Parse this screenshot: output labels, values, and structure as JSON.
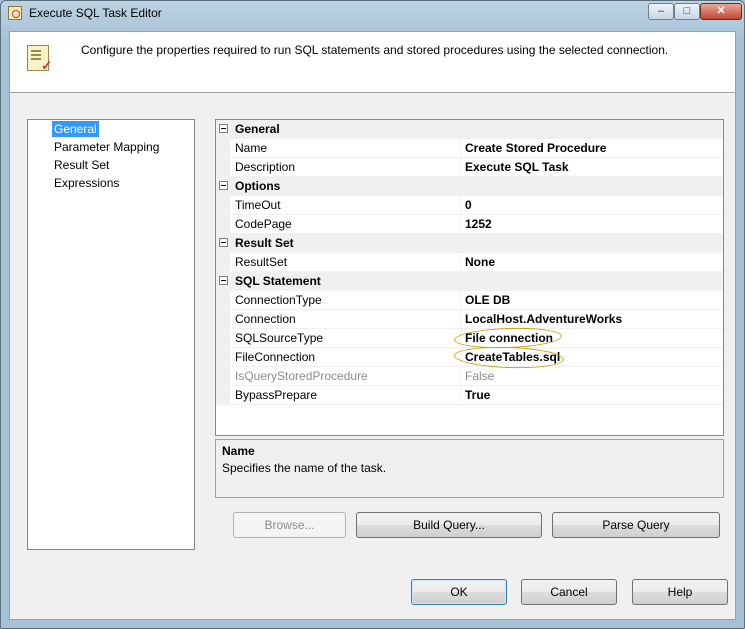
{
  "window": {
    "title": "Execute SQL Task Editor",
    "controls": {
      "minimize": "–",
      "maximize": "□",
      "close": "✕"
    }
  },
  "header": {
    "description": "Configure the properties required to run SQL statements and stored procedures using the selected connection."
  },
  "nav": {
    "items": [
      "General",
      "Parameter Mapping",
      "Result Set",
      "Expressions"
    ],
    "selected": "General"
  },
  "properties": {
    "categories": [
      {
        "label": "General",
        "rows": [
          {
            "name": "Name",
            "value": "Create Stored Procedure"
          },
          {
            "name": "Description",
            "value": "Execute SQL Task"
          }
        ]
      },
      {
        "label": "Options",
        "rows": [
          {
            "name": "TimeOut",
            "value": "0"
          },
          {
            "name": "CodePage",
            "value": "1252"
          }
        ]
      },
      {
        "label": "Result Set",
        "rows": [
          {
            "name": "ResultSet",
            "value": "None"
          }
        ]
      },
      {
        "label": "SQL Statement",
        "rows": [
          {
            "name": "ConnectionType",
            "value": "OLE DB"
          },
          {
            "name": "Connection",
            "value": "LocalHost.AdventureWorks"
          },
          {
            "name": "SQLSourceType",
            "value": "File connection"
          },
          {
            "name": "FileConnection",
            "value": "CreateTables.sql"
          },
          {
            "name": "IsQueryStoredProcedure",
            "value": "False"
          },
          {
            "name": "BypassPrepare",
            "value": "True"
          }
        ]
      }
    ]
  },
  "help": {
    "title": "Name",
    "description": "Specifies the name of the task."
  },
  "buttons": {
    "browse": "Browse...",
    "build_query": "Build Query...",
    "parse_query": "Parse Query",
    "ok": "OK",
    "cancel": "Cancel",
    "help": "Help"
  }
}
